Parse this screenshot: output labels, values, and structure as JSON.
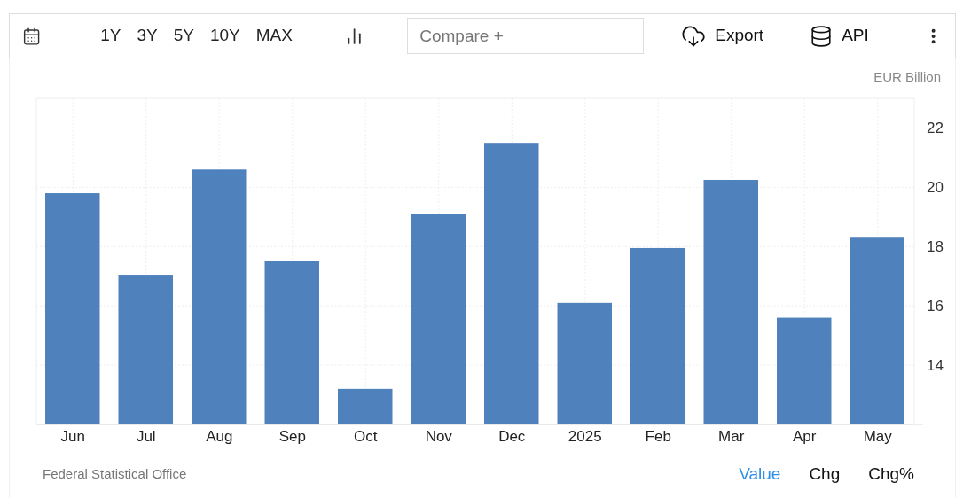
{
  "toolbar": {
    "ranges": [
      "1Y",
      "3Y",
      "5Y",
      "10Y",
      "MAX"
    ],
    "compare": {
      "placeholder": "Compare +"
    },
    "export": "Export",
    "api": "API"
  },
  "chart": {
    "unit": "EUR Billion",
    "chart_data": {
      "type": "bar",
      "categories": [
        "Jun",
        "Jul",
        "Aug",
        "Sep",
        "Oct",
        "Nov",
        "Dec",
        "2025",
        "Feb",
        "Mar",
        "Apr",
        "May"
      ],
      "grid": true,
      "series": [
        {
          "color": "#4f81bd",
          "values": [
            19.8,
            17.05,
            20.6,
            17.5,
            13.2,
            19.1,
            21.5,
            16.1,
            17.95,
            20.25,
            15.6,
            18.3
          ]
        }
      ],
      "ylim": [
        12,
        23
      ],
      "yticks": [
        14,
        16,
        18,
        20,
        22
      ]
    }
  },
  "footer": {
    "source": "Federal Statistical Office",
    "tabs": [
      {
        "label": "Value",
        "selected": true
      },
      {
        "label": "Chg",
        "selected": false
      },
      {
        "label": "Chg%",
        "selected": false
      }
    ]
  }
}
